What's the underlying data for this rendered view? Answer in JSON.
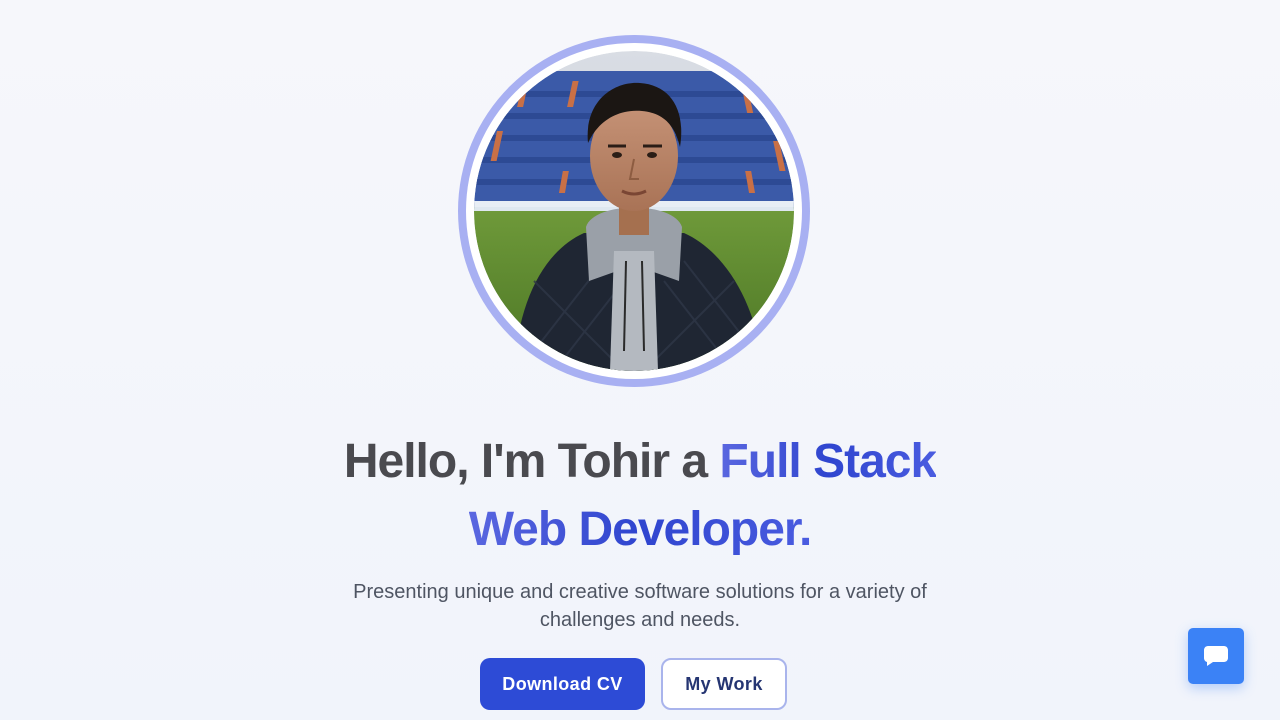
{
  "hero": {
    "avatar": {
      "alt": "Profile photo of Tohir at a stadium",
      "ring_color": "#a8b0f2"
    },
    "headline": {
      "prefix": "Hello, I'm Tohir a ",
      "accent_line1": "Full Stack",
      "accent_line2": "Web Developer."
    },
    "subtitle": "Presenting unique and creative software solutions for a variety of challenges and needs.",
    "buttons": {
      "download_cv": "Download CV",
      "my_work": "My Work"
    }
  },
  "chat_widget": {
    "icon": "chat-bubble-icon",
    "color": "#3b82f6"
  },
  "colors": {
    "primary_button": "#2d4bd6",
    "accent_gradient_start": "#5a67e0",
    "accent_gradient_end": "#2f45cf",
    "heading_text": "#4a4a4f",
    "body_text": "#4f5563"
  }
}
